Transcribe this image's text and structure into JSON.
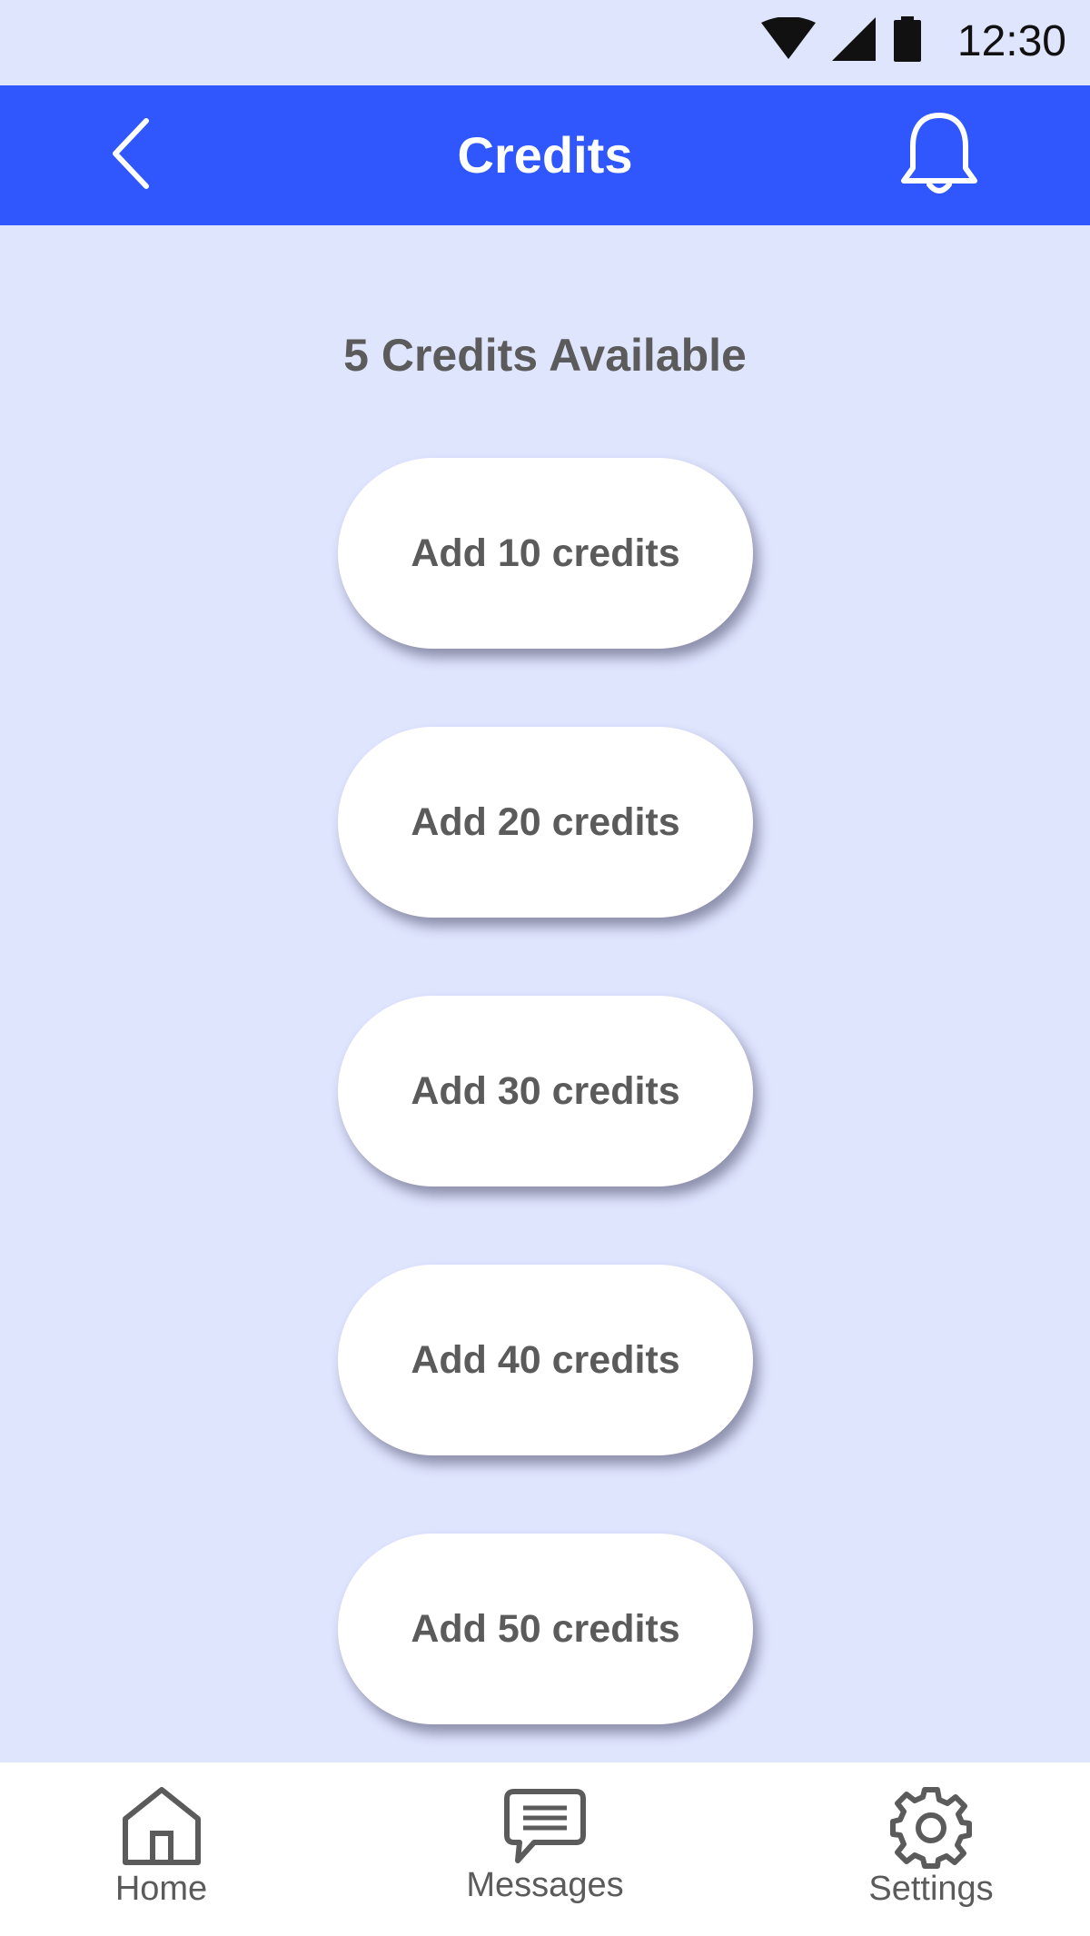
{
  "status_bar": {
    "time": "12:30",
    "icons": [
      "wifi-icon",
      "signal-icon",
      "battery-icon"
    ]
  },
  "app_bar": {
    "title": "Credits",
    "back_icon": "chevron-left-icon",
    "notification_icon": "bell-icon",
    "color": "#3057fe"
  },
  "main": {
    "credits_available": "5 Credits Available",
    "options": [
      {
        "label": "Add 10 credits"
      },
      {
        "label": "Add 20 credits"
      },
      {
        "label": "Add 30 credits"
      },
      {
        "label": "Add 40 credits"
      },
      {
        "label": "Add 50 credits"
      }
    ]
  },
  "bottom_nav": {
    "items": [
      {
        "label": "Home",
        "icon": "home-icon"
      },
      {
        "label": "Messages",
        "icon": "messages-icon"
      },
      {
        "label": "Settings",
        "icon": "settings-icon"
      }
    ]
  },
  "colors": {
    "background": "#e0e5fe",
    "accent": "#3057fe",
    "text": "#5b5b5b",
    "card": "#ffffff"
  }
}
